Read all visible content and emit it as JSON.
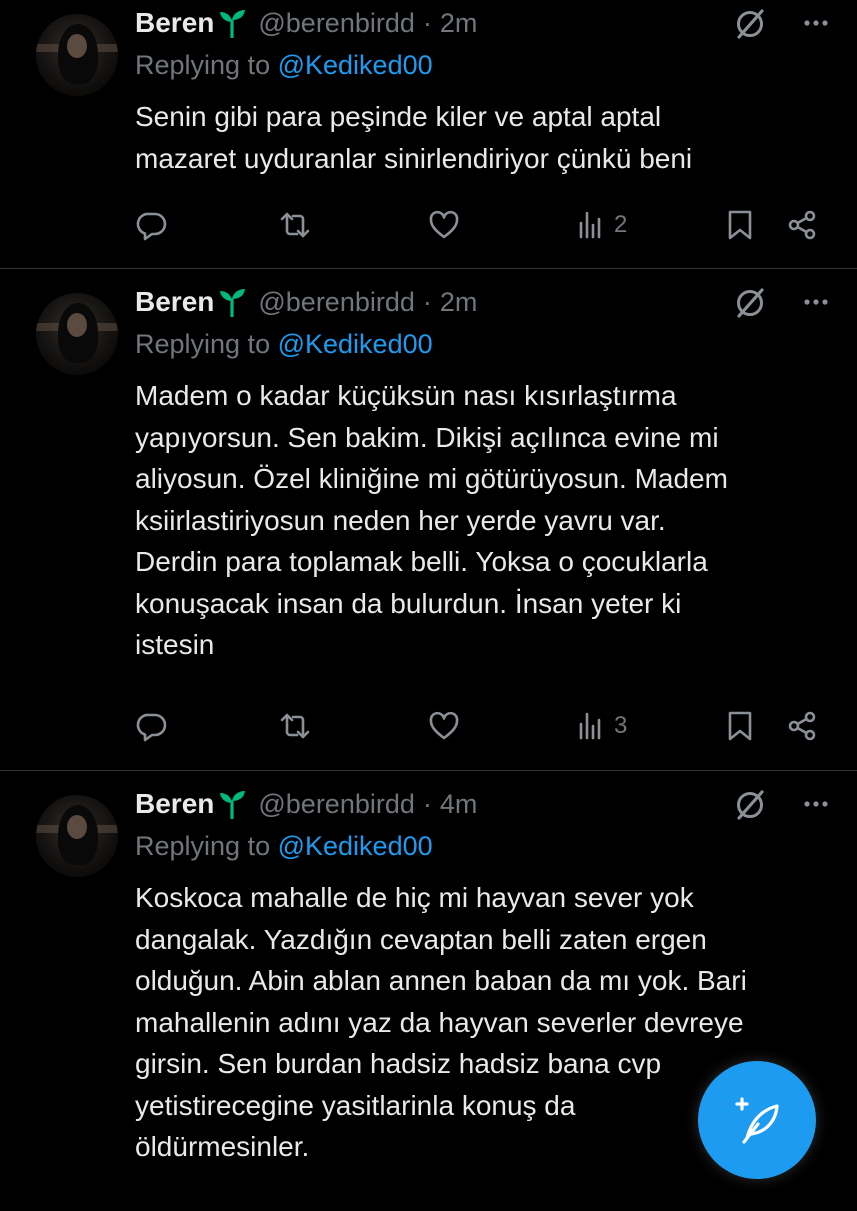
{
  "colors": {
    "background": "#000000",
    "text": "#e7e9ea",
    "muted": "#71767b",
    "accent": "#1d9bf0",
    "badge": "#00ba7c"
  },
  "tweets": [
    {
      "name": "Beren",
      "badge_icon": "sprout-icon",
      "handle": "@berenbirdd",
      "separator": "·",
      "time": "2m",
      "replying_prefix": "Replying to",
      "replying_to": "@Kediked00",
      "text": "Senin gibi para peşinde kiler ve aptal aptal\nmazaret uyduranlar sinirlendiriyor çünkü beni",
      "views": "2"
    },
    {
      "name": "Beren",
      "badge_icon": "sprout-icon",
      "handle": "@berenbirdd",
      "separator": "·",
      "time": "2m",
      "replying_prefix": "Replying to",
      "replying_to": "@Kediked00",
      "text": "Madem o kadar küçüksün nası kısırlaştırma\nyapıyorsun. Sen bakim. Dikişi açılınca evine mi\naliyosun. Özel kliniğine mi götürüyosun. Madem\nksiirlastiriyosun neden her yerde yavru var.\nDerdin para toplamak belli. Yoksa o çocuklarla\nkonuşacak insan da bulurdun. İnsan yeter ki\nistesin",
      "views": "3"
    },
    {
      "name": "Beren",
      "badge_icon": "sprout-icon",
      "handle": "@berenbirdd",
      "separator": "·",
      "time": "4m",
      "replying_prefix": "Replying to",
      "replying_to": "@Kediked00",
      "text": "Koskoca mahalle de hiç mi hayvan sever yok\ndangalak. Yazdığın cevaptan belli zaten ergen\nolduğun. Abin ablan annen baban da mı yok. Bari\nmahallenin adını yaz da hayvan severler devreye\ngirsin. Sen burdan hadsiz hadsiz bana cvp\nyetistirecegine yasitlarinla konuş da\nöldürmesinler."
    }
  ],
  "compose_button_icon": "compose-feather-icon"
}
